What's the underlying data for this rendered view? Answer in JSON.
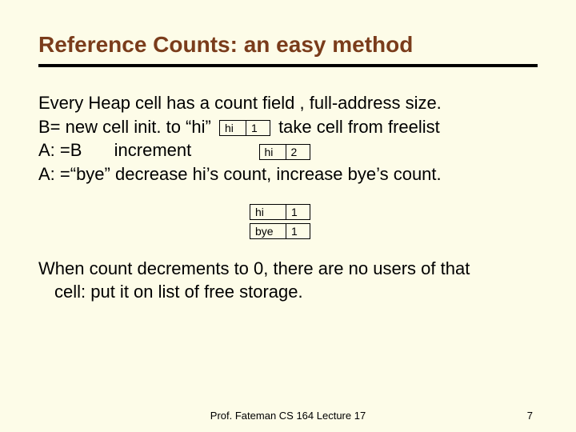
{
  "title": "Reference Counts: an easy method",
  "lines": {
    "l1": "Every Heap cell has a count field , full-address size.",
    "l2a": "B= new cell init. to “hi”",
    "l2b": "take cell from freelist",
    "l3a": "A: =B",
    "l3b": "increment",
    "l4": "A: =“bye” decrease hi’s count, increase bye’s count."
  },
  "cells": {
    "r1": {
      "label": "hi",
      "count": "1"
    },
    "r2": {
      "label": "hi",
      "count": "2"
    },
    "s1": {
      "label": "hi",
      "count": "1"
    },
    "s2": {
      "label": "bye",
      "count": "1"
    }
  },
  "para2a": "When count decrements to 0, there are no users of that",
  "para2b": "cell: put it on list of free storage.",
  "footer": {
    "center": "Prof. Fateman CS 164 Lecture 17",
    "num": "7"
  }
}
